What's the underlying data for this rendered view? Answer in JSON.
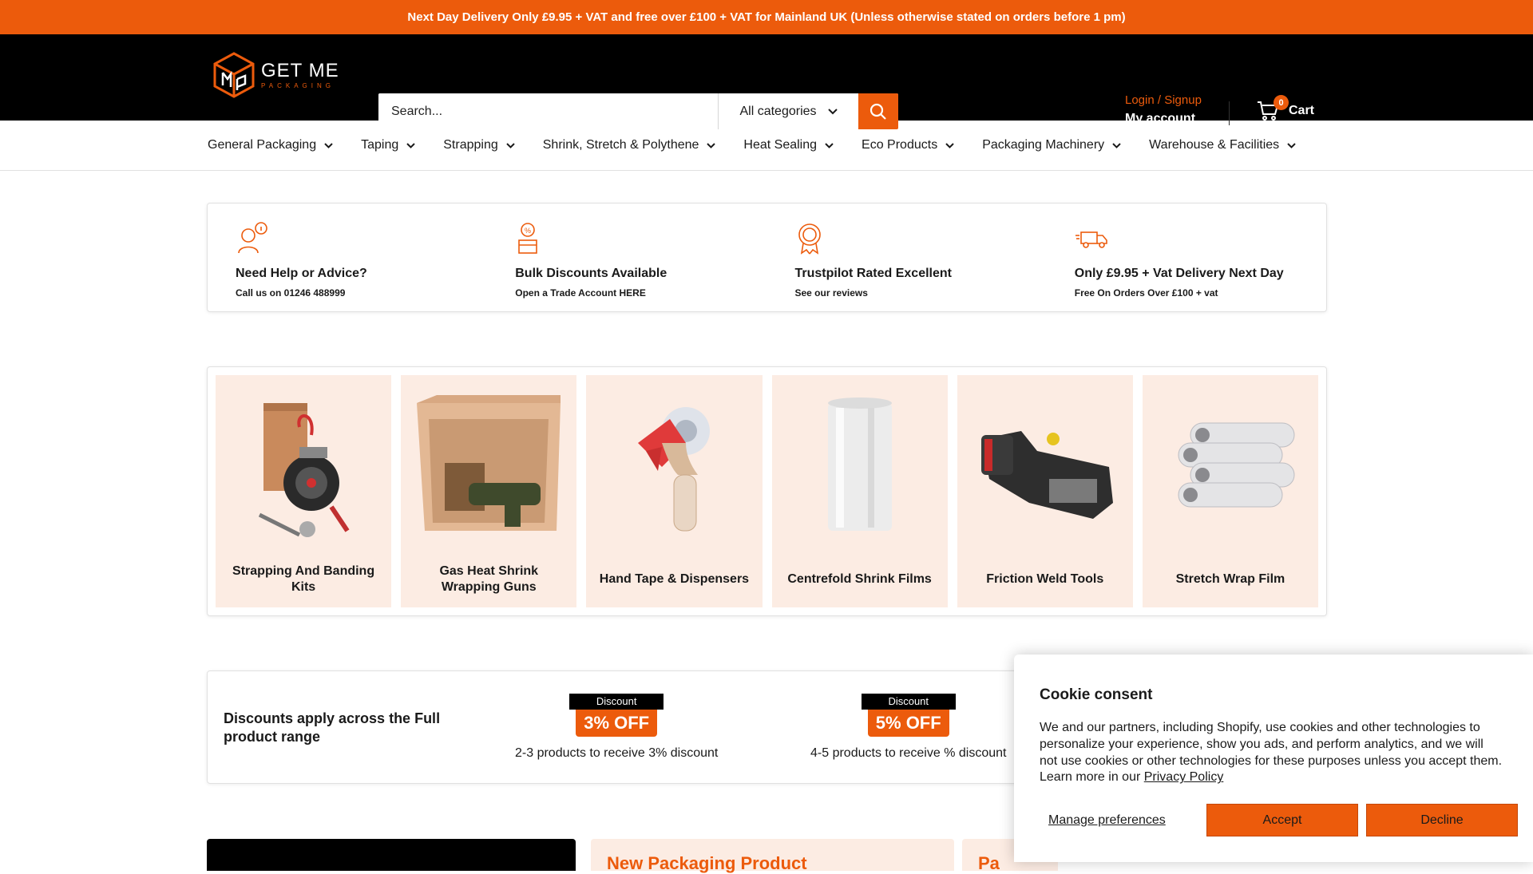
{
  "announcement": "Next Day Delivery Only £9.95 + VAT and free over £100 + VAT for Mainland UK (Unless otherwise stated on orders before 1 pm)",
  "brand": {
    "name_big": "GET ME",
    "name_small": "PACKAGING"
  },
  "search": {
    "placeholder": "Search...",
    "category": "All categories"
  },
  "account": {
    "login": "Login / Signup",
    "my_account": "My account"
  },
  "cart": {
    "label": "Cart",
    "count": "0"
  },
  "nav": [
    {
      "label": "General Packaging"
    },
    {
      "label": "Taping"
    },
    {
      "label": "Strapping"
    },
    {
      "label": "Shrink, Stretch & Polythene"
    },
    {
      "label": "Heat Sealing"
    },
    {
      "label": "Eco Products"
    },
    {
      "label": "Packaging Machinery"
    },
    {
      "label": "Warehouse & Facilities"
    }
  ],
  "features": [
    {
      "icon": "support-agent-icon",
      "title": "Need Help or Advice?",
      "subtitle": "Call us on 01246 488999"
    },
    {
      "icon": "discount-box-icon",
      "title": "Bulk Discounts Available",
      "subtitle": "Open a Trade Account HERE"
    },
    {
      "icon": "award-badge-icon",
      "title": "Trustpilot Rated Excellent",
      "subtitle": "See our reviews"
    },
    {
      "icon": "delivery-truck-icon",
      "title": "Only £9.95 + Vat Delivery Next Day",
      "subtitle": "Free On Orders Over £100 + vat"
    }
  ],
  "categories": [
    {
      "label": "Strapping And Banding Kits"
    },
    {
      "label": "Gas Heat Shrink Wrapping Guns"
    },
    {
      "label": "Hand Tape & Dispensers"
    },
    {
      "label": "Centrefold Shrink Films"
    },
    {
      "label": "Friction Weld Tools"
    },
    {
      "label": "Stretch Wrap Film"
    }
  ],
  "discounts": {
    "title": "Discounts apply across the Full product range",
    "items": [
      {
        "ribbon": "Discount",
        "off": "3% OFF",
        "text": "2-3 products to receive 3% discount"
      },
      {
        "ribbon": "Discount",
        "off": "5% OFF",
        "text": "4-5 products to receive % discount"
      }
    ]
  },
  "bottom": {
    "peach1": "New Packaging Product",
    "peach2": "Pa"
  },
  "cookie": {
    "title": "Cookie consent",
    "body": "We and our partners, including Shopify, use cookies and other technologies to personalize your experience, show you ads, and perform analytics, and we will not use cookies or other technologies for these purposes unless you accept them. Learn more in our ",
    "link": "Privacy Policy",
    "manage": "Manage preferences",
    "accept": "Accept",
    "decline": "Decline"
  },
  "colors": {
    "brand_orange": "#ec5b0c",
    "peach": "#fcece3",
    "header_bg": "#000000"
  }
}
